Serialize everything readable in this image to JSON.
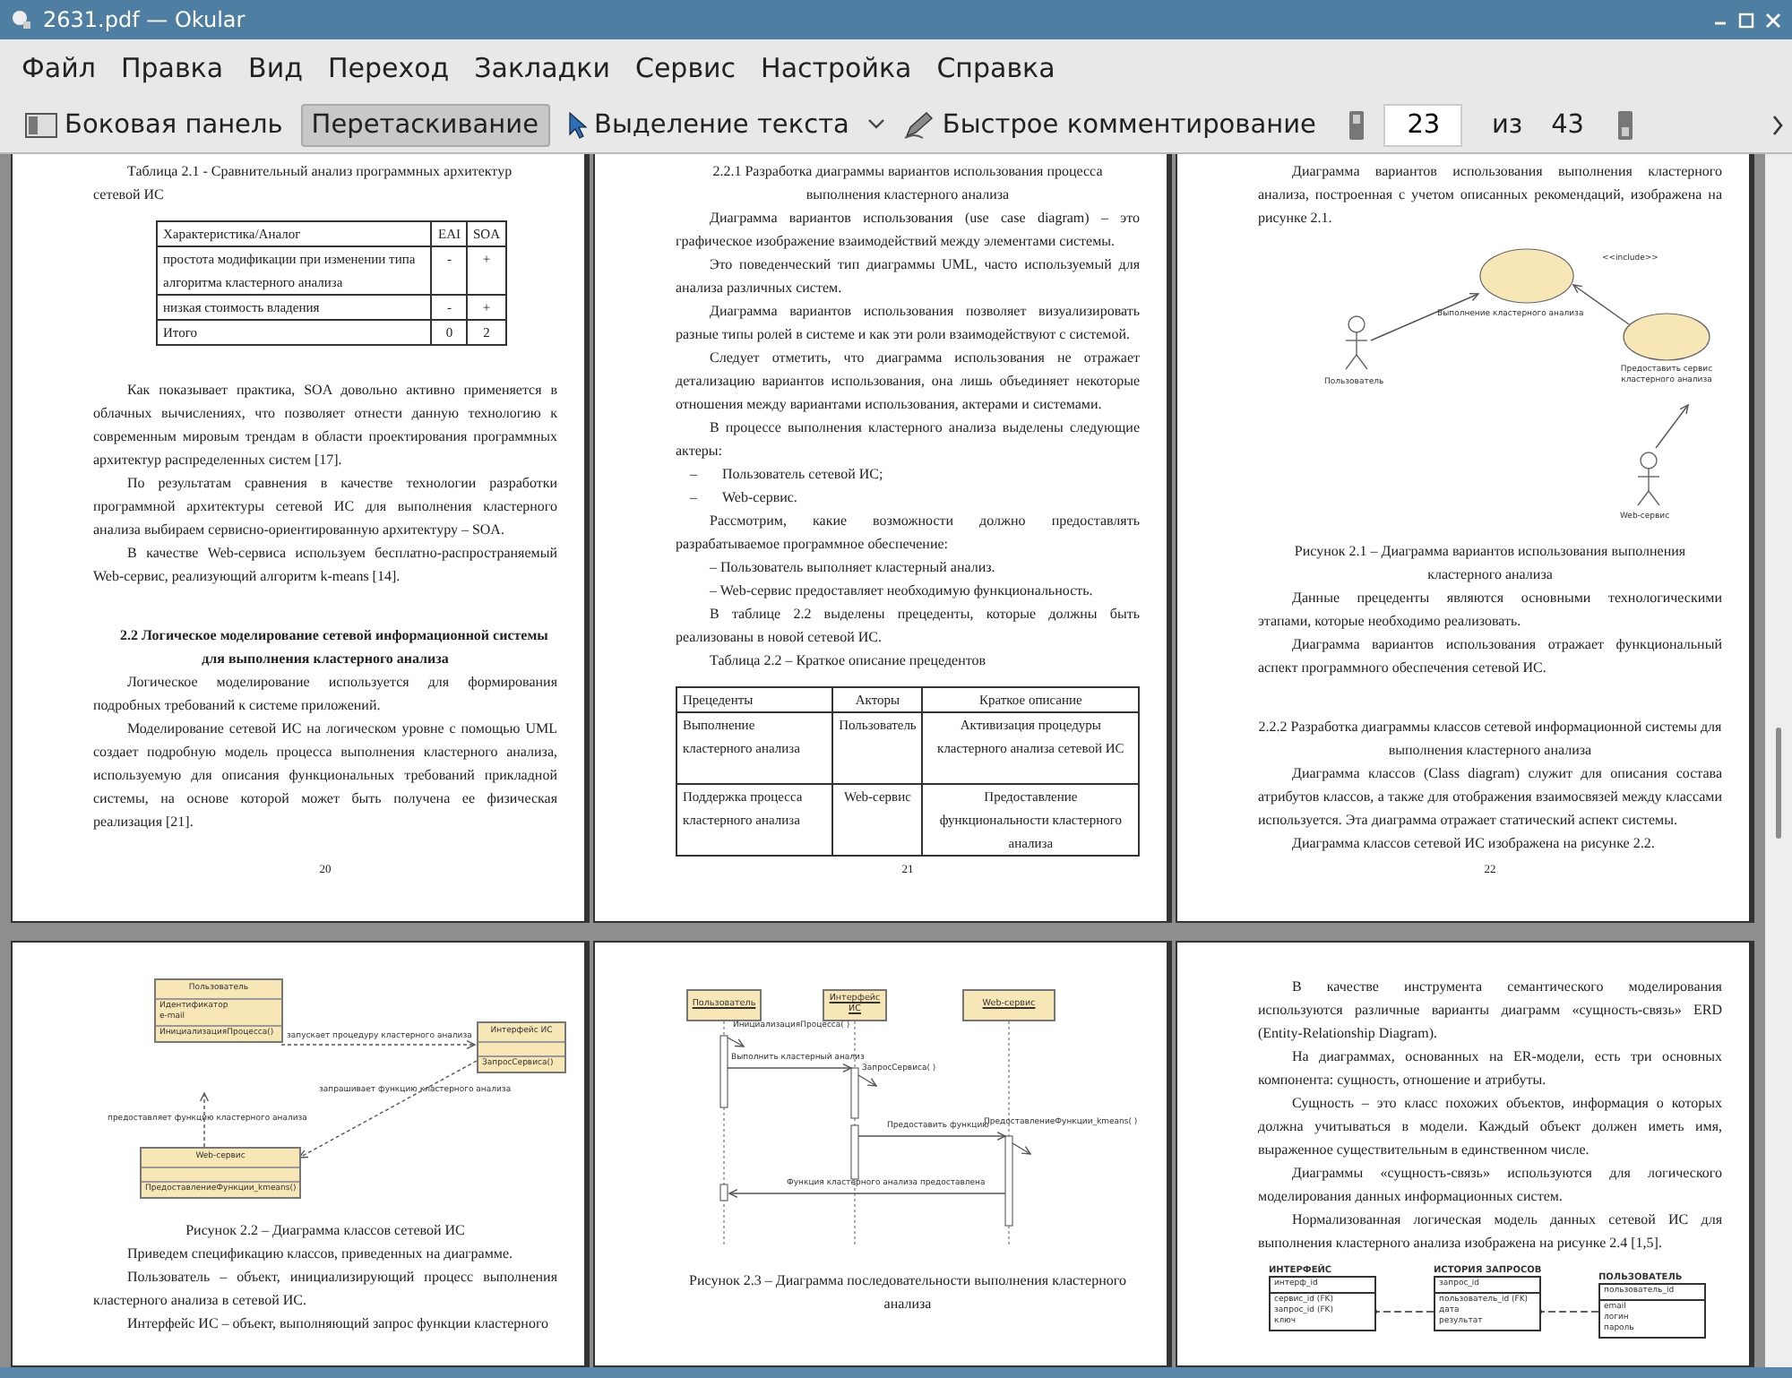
{
  "window": {
    "title": "2631.pdf — Okular"
  },
  "menu": [
    "Файл",
    "Правка",
    "Вид",
    "Переход",
    "Закладки",
    "Сервис",
    "Настройка",
    "Справка"
  ],
  "toolbar": {
    "items": [
      {
        "kind": "sidebar",
        "label": "Боковая панель",
        "selected": false
      },
      {
        "kind": "browse",
        "label": "Перетаскивание",
        "selected": true
      },
      {
        "kind": "select",
        "label": "Выделение текста",
        "selected": false
      },
      {
        "kind": "annotate",
        "label": "Быстрое комментирование",
        "selected": false
      }
    ],
    "page_field": "23",
    "of_label": "из",
    "page_total": "43"
  },
  "pages": [
    {
      "number": "20",
      "blocks": [
        {
          "kind": "table_caption",
          "text": "Таблица 2.1 -  Сравнительный анализ программных архитектур сетевой ИС"
        },
        {
          "kind": "table",
          "columns": [
            "Характеристика/Аналог",
            "EAI",
            "SOA"
          ],
          "rows": [
            [
              "простота модификации при изменении типа алгоритма кластерного анализа",
              "-",
              "+"
            ],
            [
              "низкая стоимость владения",
              "-",
              "+"
            ],
            [
              "Итого",
              "0",
              "2"
            ]
          ]
        },
        {
          "kind": "para",
          "text": "Как показывает практика,  SOA довольно активно применяется в облачных вычислениях, что  позволяет отнести данную технологию к современным мировым трендам в  области проектирования программных архитектур распределенных систем [17]."
        },
        {
          "kind": "para",
          "text": "По результатам сравнения в качестве технологии разработки программной архитектуры сетевой ИС для выполнения кластерного анализа выбираем сервисно-ориентированную архитектуру – SOA."
        },
        {
          "kind": "para",
          "text": "В качестве Web-сервиса используем бесплатно-распространяемый Web-сервис, реализующий алгоритм k-means [14]."
        },
        {
          "kind": "heading",
          "text": "2.2 Логическое моделирование сетевой информационной системы для выполнения кластерного анализа"
        },
        {
          "kind": "para",
          "text": "Логическое моделирование используется для формирования подробных требований к системе приложений."
        },
        {
          "kind": "para",
          "text": "Моделирование сетевой ИС на логическом уровне с помощью UML создает подробную модель процесса выполнения кластерного анализа, используемую для описания функциональных требований прикладной системы, на основе которой может быть получена ее физическая реализация [21]."
        }
      ]
    },
    {
      "number": "21",
      "blocks": [
        {
          "kind": "subheading",
          "text": "2.2.1 Разработка диаграммы вариантов использования процесса выполнения кластерного анализа"
        },
        {
          "kind": "para",
          "text": "Диаграмма вариантов использования (use case diagram) – это графическое изображение взаимодействий между элементами системы."
        },
        {
          "kind": "para",
          "text": "Это поведенческий тип диаграммы  UML,  часто используемый для анализа различных систем."
        },
        {
          "kind": "para",
          "text": "Диаграмма вариантов использования позволяет визуализировать разные типы ролей в системе и как эти роли взаимодействуют с системой."
        },
        {
          "kind": "para",
          "text": "Следует отметить, что диаграмма использования не отражает детализацию вариантов использования, она лишь объединяет некоторые отношения между вариантами использования, актерами и системами."
        },
        {
          "kind": "para",
          "text": "В процессе выполнения кластерного анализа выделены следующие актеры:"
        },
        {
          "kind": "list_item",
          "marker": "–",
          "text": "Пользователь сетевой ИС;"
        },
        {
          "kind": "list_item",
          "marker": "–",
          "text": "Web-сервис."
        },
        {
          "kind": "para",
          "text": "Рассмотрим, какие возможности должно предоставлять разрабатываемое программное обеспечение:"
        },
        {
          "kind": "para",
          "text": "– Пользователь выполняет кластерный анализ."
        },
        {
          "kind": "para",
          "text": "– Web-сервис предоставляет необходимую функциональность."
        },
        {
          "kind": "para",
          "text": "В таблице 2.2 выделены прецеденты, которые должны быть реализованы в новой сетевой ИС."
        },
        {
          "kind": "table_caption",
          "text": "Таблица 2.2 – Краткое описание прецедентов"
        },
        {
          "kind": "table",
          "columns": [
            "Прецеденты",
            "Акторы",
            "Краткое описание"
          ],
          "rows": [
            [
              "Выполнение кластерного анализа",
              "Пользователь",
              "Активизация процедуры кластерного анализа сетевой ИС"
            ],
            [
              "Поддержка процесса кластерного анализа",
              "Web-сервис",
              "Предоставление функциональности кластерного анализа"
            ]
          ]
        }
      ]
    },
    {
      "number": "22",
      "blocks": [
        {
          "kind": "para",
          "text": "Диаграмма  вариантов использования выполнения кластерного анализа, построенная с учетом описанных рекомендаций, изображена на рисунке 2.1."
        },
        {
          "kind": "figure",
          "diagram": {
            "kind": "use_case_diagram",
            "use_cases": [
              "Выполнение кластерного анализа",
              "Предоставить сервис кластерного анализа"
            ],
            "actors": [
              "Пользователь",
              "Web-сервис"
            ],
            "stereotype": "<<include>>"
          }
        },
        {
          "kind": "figure_caption",
          "text": "Рисунок 2.1 – Диаграмма  вариантов использования выполнения кластерного анализа"
        },
        {
          "kind": "para",
          "text": "Данные прецеденты являются основными технологическими этапами, которые необходимо реализовать."
        },
        {
          "kind": "para",
          "text": "Диаграмма вариантов использования отражает функциональный аспект программного обеспечения сетевой ИС."
        },
        {
          "kind": "subheading",
          "text": "2.2.2 Разработка диаграммы классов сетевой информационной системы для выполнения кластерного анализа"
        },
        {
          "kind": "para",
          "text": "Диаграмма классов (Class diagram) служит для описания состава атрибутов классов, а также для отображения взаимосвязей между классами используется. Эта диаграмма отражает статический аспект системы."
        },
        {
          "kind": "para",
          "text": "Диаграмма классов сетевой  ИС изображена на рисунке 2.2."
        }
      ]
    },
    {
      "blocks": [
        {
          "kind": "figure",
          "diagram": {
            "kind": "class_diagram",
            "classes": [
              {
                "name": "Пользователь",
                "attributes": [
                  "Идентификатор",
                  "e-mail"
                ],
                "operations": [
                  "ИнициализацияПроцесса()"
                ]
              },
              {
                "name": "Интерфейс ИС",
                "operations": [
                  "ЗапросСервиса()"
                ]
              },
              {
                "name": "Web-сервис",
                "operations": [
                  "ПредоставлениеФункции_kmeans()"
                ]
              }
            ],
            "relations": [
              "запускает процедуру кластерного анализа",
              "запрашивает функцию кластерного анализа",
              "предоставляет функцию кластерного анализа"
            ]
          }
        },
        {
          "kind": "figure_caption",
          "text": "Рисунок 2.2 – Диаграмма  классов сетевой ИС"
        },
        {
          "kind": "para",
          "text": "Приведем спецификацию классов, приведенных на диаграмме."
        },
        {
          "kind": "para",
          "text": "Пользователь  –  объект,   инициализирующий  процесс  выполнения кластерного анализа в сетевой ИС."
        },
        {
          "kind": "para",
          "text": "Интерфейс ИС – объект, выполняющий запрос функции кластерного"
        }
      ]
    },
    {
      "blocks": [
        {
          "kind": "figure",
          "diagram": {
            "kind": "sequence_diagram",
            "lifelines": [
              "Пользователь",
              "Интерфейс ИС",
              "Web-сервис"
            ],
            "messages": [
              "ИнициализацияПроцесса( )",
              "Выполнить кластерный анализ",
              "ЗапросСервиса( )",
              "Предоставить функцию",
              "ПредоставлениеФункции_kmeans( )",
              "Функция кластерного анализа предоставлена"
            ]
          }
        },
        {
          "kind": "figure_caption",
          "text": "Рисунок 2.3 – Диаграмма последовательности выполнения кластерного анализа"
        }
      ]
    },
    {
      "blocks": [
        {
          "kind": "para",
          "text": "В качестве инструмента семантического моделирования используются различные варианты диаграмм «сущность-связь» ERD (Entity-Relationship Diagram)."
        },
        {
          "kind": "para",
          "text": "На диаграммах, основанных на ER-модели, есть три основных компонента: сущность, отношение и атрибуты."
        },
        {
          "kind": "para",
          "text": "Сущность – это класс похожих объектов, информация о которых должна учитываться в модели. Каждый объект должен иметь имя, выраженное существительным в единственном числе."
        },
        {
          "kind": "para",
          "text": "Диаграммы «сущность-связь» используются для логического моделирования данных информационных систем."
        },
        {
          "kind": "para",
          "text": "Нормализованная логическая модель данных сетевой ИС для выполнения кластерного анализа изображена на рисунке 2.4 [1,5]."
        },
        {
          "kind": "figure",
          "diagram": {
            "kind": "er_diagram",
            "entities": [
              {
                "name": "ИНТЕРФЕЙС",
                "key": "интерф_id",
                "attributes": [
                  "сервис_id (FK)",
                  "запрос_id (FK)",
                  "ключ"
                ]
              },
              {
                "name": "ИСТОРИЯ ЗАПРОСОВ",
                "key": "запрос_id",
                "attributes": [
                  "пользователь_id (FK)",
                  "дата",
                  "результат"
                ]
              },
              {
                "name": "ПОЛЬЗОВАТЕЛЬ",
                "key": "пользователь_id",
                "attributes": [
                  "email",
                  "логин",
                  "пароль"
                ]
              }
            ]
          }
        }
      ]
    }
  ]
}
